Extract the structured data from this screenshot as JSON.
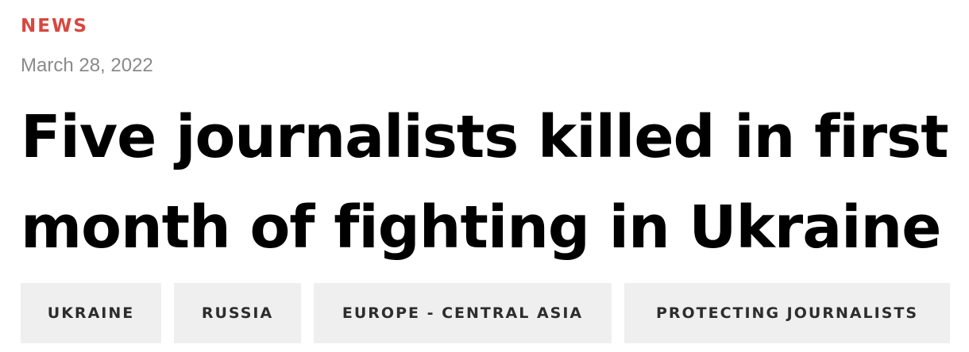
{
  "article": {
    "category": "NEWS",
    "date": "March 28, 2022",
    "headline": "Five journalists killed in first month of fighting in Ukraine",
    "tags": [
      "UKRAINE",
      "RUSSIA",
      "EUROPE - CENTRAL ASIA",
      "PROTECTING JOURNALISTS"
    ]
  },
  "colors": {
    "category": "#d8473f",
    "date": "#8a8a8a",
    "headline": "#000000",
    "tag_background": "#efefef",
    "tag_text": "#2d2d2d"
  }
}
